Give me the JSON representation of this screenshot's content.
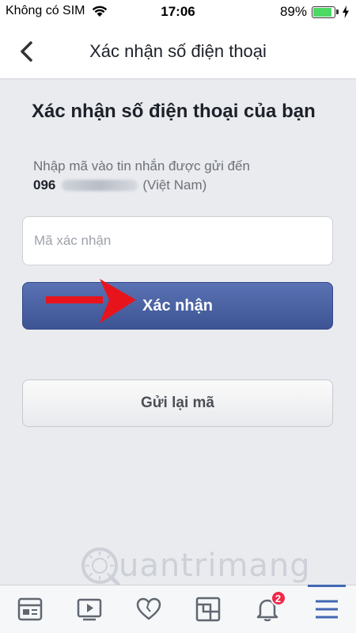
{
  "status_bar": {
    "carrier": "Không có SIM",
    "time": "17:06",
    "battery_percent": "89%",
    "battery_level": 0.89,
    "battery_color": "#4cd964"
  },
  "nav": {
    "title": "Xác nhận số điện thoại",
    "back_icon": "chevron-left-icon"
  },
  "main": {
    "heading": "Xác nhận số điện thoại của bạn",
    "instruction": "Nhập mã vào tin nhắn được gửi đến",
    "phone_prefix": "096",
    "phone_country": "(Việt Nam)",
    "code_placeholder": "Mã xác nhận",
    "code_value": "",
    "confirm_label": "Xác nhận",
    "resend_label": "Gửi lại mã",
    "annotation_arrow_color": "#e8141c",
    "confirm_color": "#4b63a4"
  },
  "watermark": {
    "text": "uantrimang"
  },
  "tab_bar": {
    "tabs": [
      {
        "icon": "news-feed-icon"
      },
      {
        "icon": "video-icon"
      },
      {
        "icon": "heart-icon"
      },
      {
        "icon": "marketplace-icon"
      },
      {
        "icon": "bell-icon",
        "badge": "2"
      },
      {
        "icon": "menu-icon",
        "active": true
      }
    ],
    "active_color": "#4267b2"
  }
}
